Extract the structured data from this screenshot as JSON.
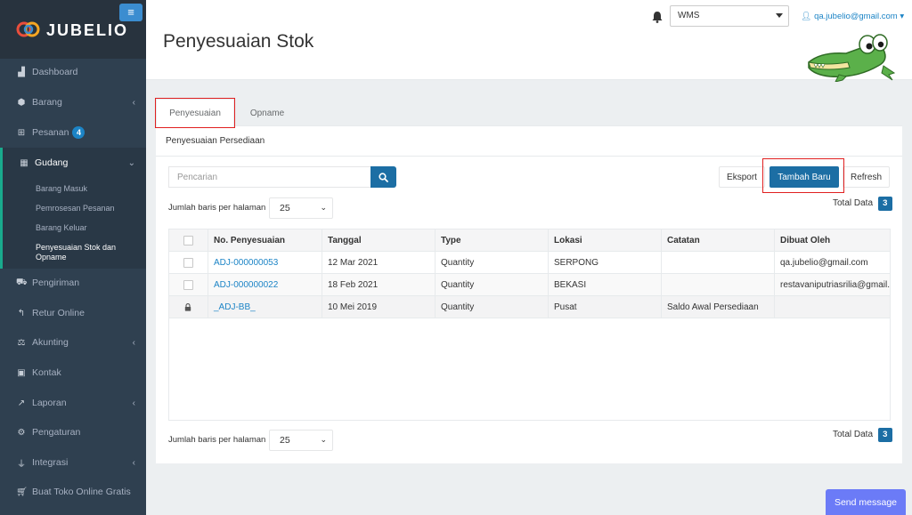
{
  "brand": {
    "name": "JUBELIO"
  },
  "sidebar": {
    "items": [
      {
        "label": "Dashboard",
        "icon": "area-chart-icon"
      },
      {
        "label": "Barang",
        "icon": "cubes-icon"
      },
      {
        "label": "Pesanan",
        "icon": "basket-icon",
        "badge": "4"
      },
      {
        "label": "Gudang",
        "icon": "building-icon"
      },
      {
        "label": "Pengiriman",
        "icon": "truck-icon"
      },
      {
        "label": "Retur Online",
        "icon": "reply-icon"
      },
      {
        "label": "Akunting",
        "icon": "balance-scale-icon"
      },
      {
        "label": "Kontak",
        "icon": "address-card-icon"
      },
      {
        "label": "Laporan",
        "icon": "line-chart-icon"
      },
      {
        "label": "Pengaturan",
        "icon": "cogs-icon"
      },
      {
        "label": "Integrasi",
        "icon": "plug-icon"
      },
      {
        "label": "Buat Toko Online Gratis",
        "icon": "shopping-cart-icon"
      }
    ],
    "gudang_sub": [
      "Barang Masuk",
      "Pemrosesan Pesanan",
      "Barang Keluar",
      "Penyesuaian Stok dan Opname"
    ]
  },
  "header": {
    "title": "Penyesuaian Stok",
    "warehouse": "WMS",
    "user_email": "qa.jubelio@gmail.com"
  },
  "tabs": [
    "Penyesuaian",
    "Opname"
  ],
  "section_title": "Penyesuaian Persediaan",
  "search": {
    "placeholder": "Pencarian"
  },
  "buttons": {
    "export": "Eksport",
    "add_new": "Tambah Baru",
    "refresh": "Refresh"
  },
  "pagination": {
    "rows_label": "Jumlah baris per halaman",
    "rows_value": "25",
    "total_label": "Total Data",
    "total_count": "3"
  },
  "table": {
    "columns": [
      "No. Penyesuaian",
      "Tanggal",
      "Type",
      "Lokasi",
      "Catatan",
      "Dibuat Oleh"
    ],
    "rows": [
      {
        "no": "ADJ-000000053",
        "date": "12 Mar 2021",
        "type": "Quantity",
        "location": "SERPONG",
        "note": "",
        "created_by": "qa.jubelio@gmail.com",
        "locked": false
      },
      {
        "no": "ADJ-000000022",
        "date": "18 Feb 2021",
        "type": "Quantity",
        "location": "BEKASI",
        "note": "",
        "created_by": "restavaniputriasrilia@gmail.c",
        "locked": false
      },
      {
        "no": "_ADJ-BB_",
        "date": "10 Mei 2019",
        "type": "Quantity",
        "location": "Pusat",
        "note": "Saldo Awal Persediaan",
        "created_by": "",
        "locked": true
      }
    ]
  },
  "chat": {
    "label": "Send message"
  },
  "colors": {
    "sidebar": "#2f4050",
    "primary": "#1c6ea4",
    "accent": "#19aa8d",
    "highlight": "#e02020"
  }
}
